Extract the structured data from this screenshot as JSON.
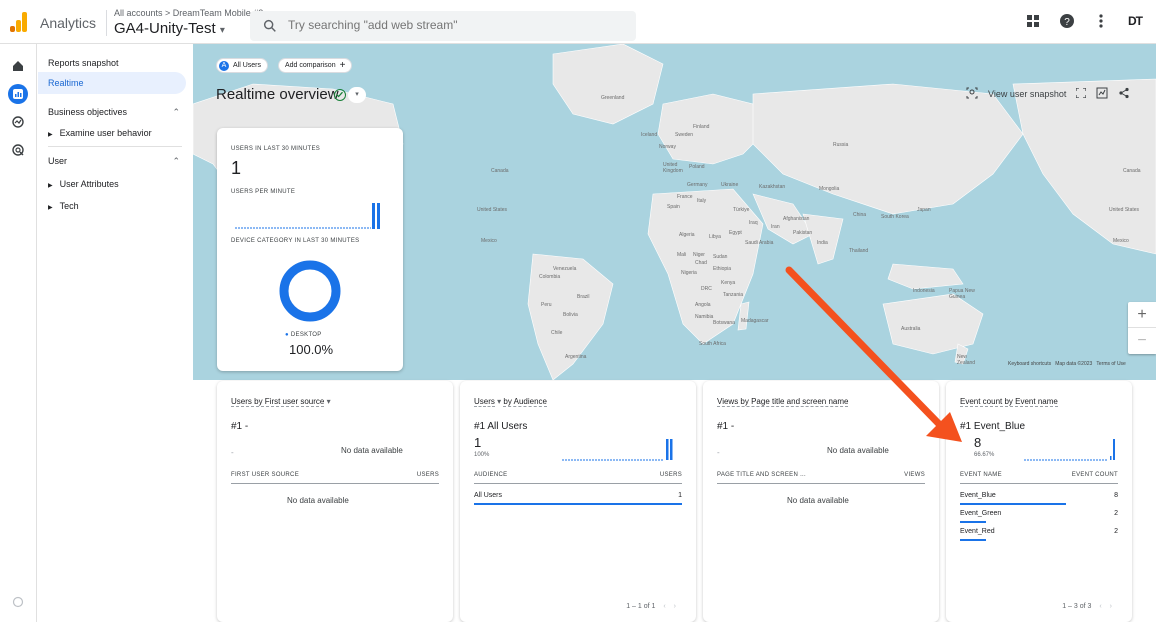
{
  "header": {
    "app_name": "Analytics",
    "breadcrumb": "All accounts > DreamTeam Mobile #2",
    "property": "GA4-Unity-Test",
    "property_caret": "▾",
    "search_placeholder": "Try searching \"add web stream\"",
    "brand_badge": "DT"
  },
  "sidenav": {
    "reports_snapshot": "Reports snapshot",
    "realtime": "Realtime",
    "business_objectives": "Business objectives",
    "examine_user_behavior": "Examine user behavior",
    "user": "User",
    "user_attributes": "User Attributes",
    "tech": "Tech"
  },
  "toolbar": {
    "all_users_chip": "All Users",
    "all_users_badge": "A",
    "add_comparison": "Add comparison",
    "title": "Realtime overview",
    "view_snapshot": "View user snapshot"
  },
  "map": {
    "labels": {
      "greenland": "Greenland",
      "iceland": "Iceland",
      "sweden": "Sweden",
      "finland": "Finland",
      "norway": "Norway",
      "russia": "Russia",
      "uk": "United Kingdom",
      "poland": "Poland",
      "germany": "Germany",
      "ukraine": "Ukraine",
      "kazakhstan": "Kazakhstan",
      "mongolia": "Mongolia",
      "france": "France",
      "italy": "Italy",
      "spain": "Spain",
      "turkiye": "Türkiye",
      "china": "China",
      "japan": "Japan",
      "south_korea": "South Korea",
      "iraq": "Iraq",
      "iran": "Iran",
      "afghanistan": "Afghanistan",
      "pakistan": "Pakistan",
      "algeria": "Algeria",
      "libya": "Libya",
      "egypt": "Egypt",
      "saudi_arabia": "Saudi Arabia",
      "india": "India",
      "thailand": "Thailand",
      "mali": "Mali",
      "niger": "Niger",
      "chad": "Chad",
      "sudan": "Sudan",
      "nigeria": "Nigeria",
      "ethiopia": "Ethiopia",
      "drc": "DRC",
      "kenya": "Kenya",
      "tanzania": "Tanzania",
      "angola": "Angola",
      "namibia": "Namibia",
      "botswana": "Botswana",
      "madagascar": "Madagascar",
      "south_africa": "South Africa",
      "indonesia": "Indonesia",
      "png": "Papua New Guinea",
      "australia": "Australia",
      "nz": "New Zealand",
      "canada_l": "Canada",
      "canada_r": "Canada",
      "us_l": "United States",
      "us_r": "United States",
      "mexico_l": "Mexico",
      "mexico_r": "Mexico",
      "venezuela": "Venezuela",
      "colombia": "Colombia",
      "peru": "Peru",
      "brazil": "Brazil",
      "bolivia": "Bolivia",
      "chile": "Chile",
      "argentina": "Argentina"
    },
    "attribution": {
      "keyboard": "Keyboard shortcuts",
      "mapdata": "Map data ©2023",
      "terms": "Terms of Use"
    },
    "zoom_in": "+",
    "zoom_out": "−"
  },
  "realtime_card": {
    "users_30_label": "USERS IN LAST 30 MINUTES",
    "users_30_value": "1",
    "users_per_minute_label": "USERS PER MINUTE",
    "device_label": "DEVICE CATEGORY IN LAST 30 MINUTES",
    "device_legend": "DESKTOP",
    "device_pct": "100.0%"
  },
  "cards": {
    "first_user_source": {
      "title": "Users by First user source",
      "caret": "▾",
      "rank": "#1  -",
      "dash": "-",
      "nodata_top": "No data available",
      "col1": "FIRST USER SOURCE",
      "col2": "USERS",
      "nodata_table": "No data available"
    },
    "audience": {
      "title_a": "Users",
      "caret": "▾",
      "title_b": "by Audience",
      "rank": "#1  All Users",
      "value": "1",
      "pct": "100%",
      "col1": "AUDIENCE",
      "col2": "USERS",
      "row_name": "All Users",
      "row_value": "1",
      "pager": "1 – 1 of 1"
    },
    "views": {
      "title": "Views by Page title and screen name",
      "rank": "#1  -",
      "dash": "-",
      "nodata_top": "No data available",
      "col1": "PAGE TITLE AND SCREEN ...",
      "col2": "VIEWS",
      "nodata_table": "No data available"
    },
    "events": {
      "title": "Event count by Event name",
      "rank": "#1  Event_Blue",
      "value": "8",
      "pct": "66.67%",
      "col1": "EVENT NAME",
      "col2": "EVENT COUNT",
      "rows": [
        {
          "name": "Event_Blue",
          "value": "8"
        },
        {
          "name": "Event_Green",
          "value": "2"
        },
        {
          "name": "Event_Red",
          "value": "2"
        }
      ],
      "pager": "1 – 3 of 3"
    }
  },
  "colors": {
    "accent": "#1a73e8",
    "annotation_arrow": "#f4511e"
  },
  "icons": {
    "home": "home-icon",
    "reports": "reports-icon",
    "explore": "explore-icon",
    "advertising": "advertising-icon",
    "apps": "apps-grid-icon",
    "help": "help-icon",
    "more": "more-vert-icon"
  }
}
